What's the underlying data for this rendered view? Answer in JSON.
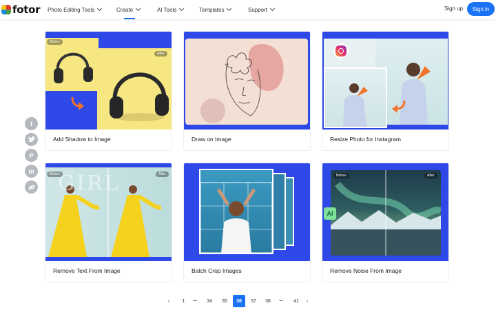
{
  "header": {
    "logo": "fotor",
    "nav": [
      {
        "label": "Photo Editing Tools",
        "active": false
      },
      {
        "label": "Create",
        "active": true
      },
      {
        "label": "AI Tools",
        "active": false
      },
      {
        "label": "Templates",
        "active": false
      },
      {
        "label": "Support",
        "active": false
      }
    ],
    "signup": "Sign up",
    "signin": "Sign in"
  },
  "social": [
    "facebook-icon",
    "twitter-icon",
    "pinterest-icon",
    "linkedin-icon",
    "link-icon"
  ],
  "cards": [
    {
      "title": "Add Shadow to Image",
      "tag_before": "Before",
      "tag_after": "After"
    },
    {
      "title": "Draw on Image"
    },
    {
      "title": "Resize Photo for Instagram"
    },
    {
      "title": "Remove Text From Image",
      "tag_before": "Before",
      "tag_after": "After",
      "overlay_text": "GIRL"
    },
    {
      "title": "Batch Crop Images"
    },
    {
      "title": "Remove Noise From Image",
      "tag_before": "Before",
      "tag_after": "After",
      "badge": "AI"
    }
  ],
  "pagination": {
    "prev": "‹",
    "pages": [
      "1",
      "•••",
      "34",
      "35",
      "36",
      "37",
      "38",
      "•••",
      "41"
    ],
    "current": "36",
    "next": "›"
  },
  "colors": {
    "accent": "#1a73f5",
    "card_blue": "#2f48e8"
  }
}
